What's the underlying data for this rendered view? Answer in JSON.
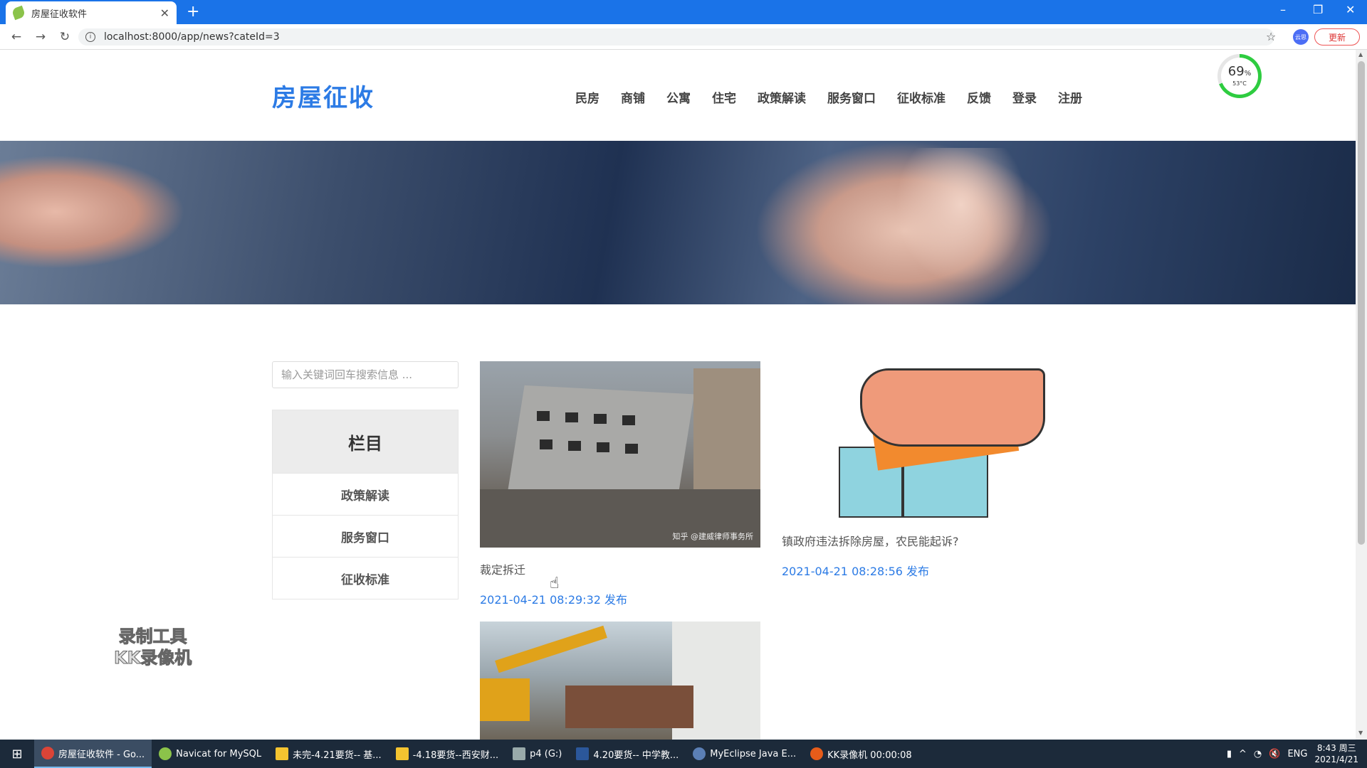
{
  "browser": {
    "tab_title": "房屋征收软件",
    "url": "localhost:8000/app/news?cateId=3",
    "update_label": "更新",
    "profile_label": "云思"
  },
  "site": {
    "logo": "房屋征收",
    "nav": [
      "民房",
      "商铺",
      "公寓",
      "住宅",
      "政策解读",
      "服务窗口",
      "征收标准",
      "反馈",
      "登录",
      "注册"
    ]
  },
  "gauge": {
    "percent": "69",
    "percent_unit": "%",
    "temp": "53°C"
  },
  "sidebar": {
    "search_placeholder": "输入关键词回车搜索信息 ...",
    "header": "栏目",
    "items": [
      "政策解读",
      "服务窗口",
      "征收标准"
    ]
  },
  "news": [
    {
      "title": "裁定拆迁",
      "date": "2021-04-21 08:29:32 发布",
      "watermark": "知乎 @建威律师事务所"
    },
    {
      "title": "镇政府违法拆除房屋，农民能起诉?",
      "date": "2021-04-21 08:28:56 发布"
    },
    {
      "title": "",
      "date": ""
    }
  ],
  "overlay_watermark": [
    "录制工具",
    "KK录像机"
  ],
  "taskbar": {
    "items": [
      "房屋征收软件 - Go...",
      "Navicat for MySQL",
      "未完-4.21要货-- 基...",
      "-4.18要货--西安财...",
      "p4 (G:)",
      "4.20要货-- 中学教...",
      "MyEclipse Java E...",
      "KK录像机 00:00:08"
    ],
    "lang": "ENG",
    "time": "8:43 周三",
    "date": "2021/4/21"
  },
  "colors": {
    "accent": "#2c7be5",
    "chrome": "#1a73e8",
    "taskbar": "#1c2a3a"
  }
}
